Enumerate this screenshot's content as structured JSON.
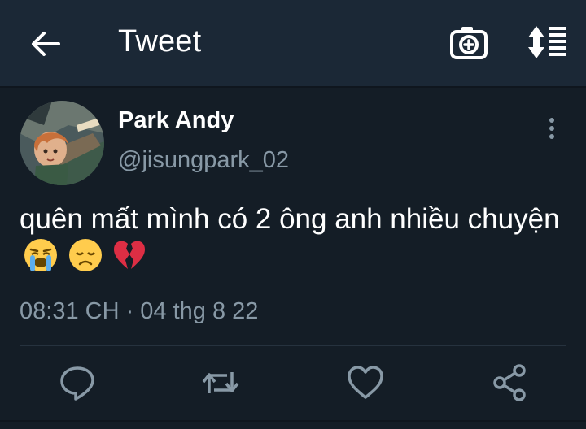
{
  "header": {
    "title": "Tweet",
    "back_icon": "arrow-left-icon",
    "camera_icon": "camera-plus-icon",
    "sort_icon": "sort-list-icon"
  },
  "tweet": {
    "author_name": "Park Andy",
    "author_handle": "@jisungpark_02",
    "text": "quên mất mình có 2 ông anh nhiều chuyện",
    "emojis": [
      "loudly-crying-face",
      "disappointed-face",
      "broken-heart"
    ],
    "timestamp": "08:31 CH · 04 thg 8 22"
  },
  "actions": [
    {
      "name": "reply",
      "icon": "reply-bubble-icon"
    },
    {
      "name": "retweet",
      "icon": "retweet-icon"
    },
    {
      "name": "like",
      "icon": "heart-icon"
    },
    {
      "name": "share",
      "icon": "share-icon"
    }
  ],
  "colors": {
    "background": "#141d26",
    "header": "#1b2836",
    "secondary_text": "#8899a6",
    "icon": "#8899a6"
  }
}
